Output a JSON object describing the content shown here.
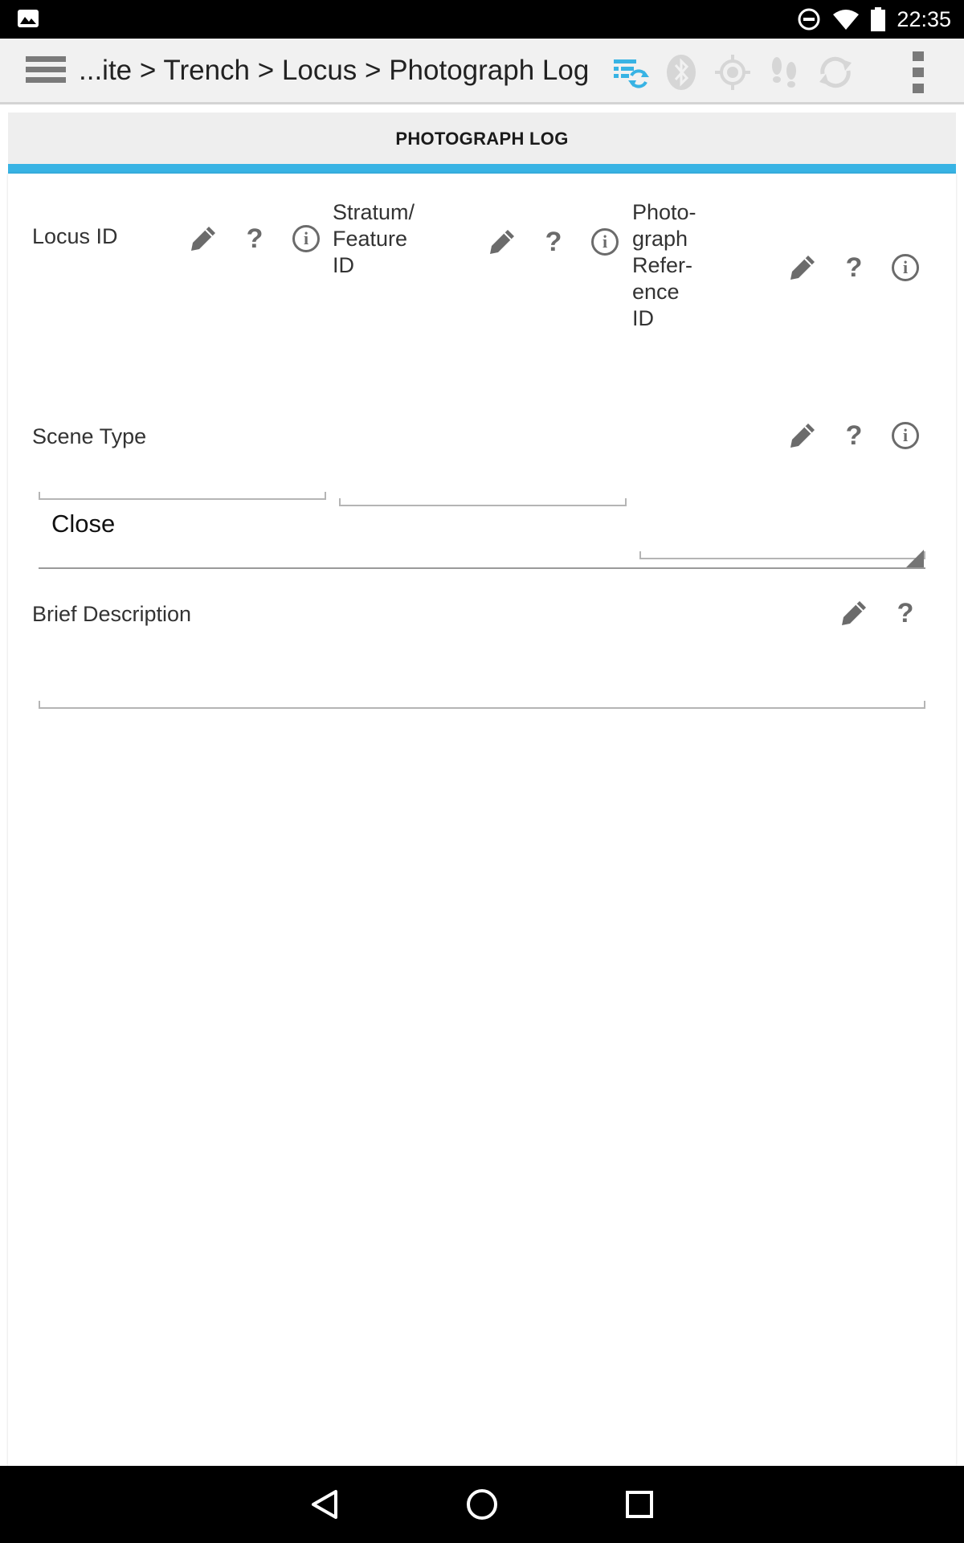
{
  "status_bar": {
    "time": "22:35",
    "icons": [
      "image-icon",
      "do-not-disturb-icon",
      "wifi-icon",
      "battery-icon"
    ]
  },
  "action_bar": {
    "breadcrumb": "...ite > Trench > Locus > Photograph Log",
    "icons": [
      "menu-icon",
      "sync-list-icon",
      "bluetooth-icon",
      "gps-target-icon",
      "footsteps-icon",
      "refresh-icon",
      "overflow-menu-icon"
    ],
    "accent_color": "#38b3e4"
  },
  "section": {
    "title": "PHOTOGRAPH LOG"
  },
  "fields": {
    "locus_id": {
      "label": "Locus ID",
      "value": ""
    },
    "stratum_feature_id": {
      "label_line1": "Stratum/",
      "label_line2": "Feature",
      "label_line3": "ID",
      "value": ""
    },
    "photo_ref_id": {
      "label_line1": "Photo-",
      "label_line2": "graph",
      "label_line3": "Refer-",
      "label_line4": "ence",
      "label_line5": "ID",
      "value": ""
    },
    "scene_type": {
      "label": "Scene Type",
      "selected": "Close"
    },
    "brief_description": {
      "label": "Brief Description",
      "value": ""
    }
  },
  "nav_bar": {
    "icons": [
      "back-icon",
      "home-icon",
      "recents-icon"
    ]
  }
}
